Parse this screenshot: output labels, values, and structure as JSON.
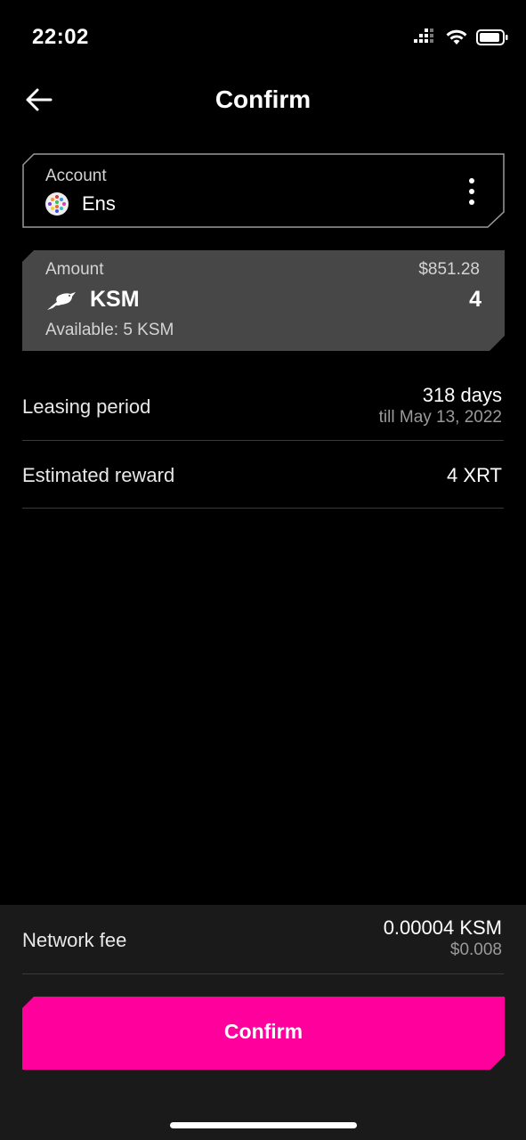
{
  "status_bar": {
    "time": "22:02",
    "icons": [
      "signal-icon",
      "wifi-icon",
      "battery-icon"
    ]
  },
  "header": {
    "title": "Confirm",
    "back_icon": "arrow-left-icon"
  },
  "account": {
    "label": "Account",
    "name": "Ens",
    "more_icon": "more-vertical-icon"
  },
  "amount": {
    "label": "Amount",
    "fiat_value": "$851.28",
    "token_symbol": "KSM",
    "value": "4",
    "available": "Available: 5 KSM",
    "token_icon": "kusama-bird-icon"
  },
  "details": [
    {
      "label": "Leasing period",
      "value": "318 days",
      "sub": "till May 13, 2022"
    },
    {
      "label": "Estimated reward",
      "value": "4 XRT"
    }
  ],
  "fee": {
    "label": "Network fee",
    "value": "0.00004 KSM",
    "fiat": "$0.008"
  },
  "confirm_button": {
    "label": "Confirm"
  },
  "colors": {
    "accent": "#FF009D",
    "card": "#474747",
    "sheet": "#1A1A1A"
  }
}
